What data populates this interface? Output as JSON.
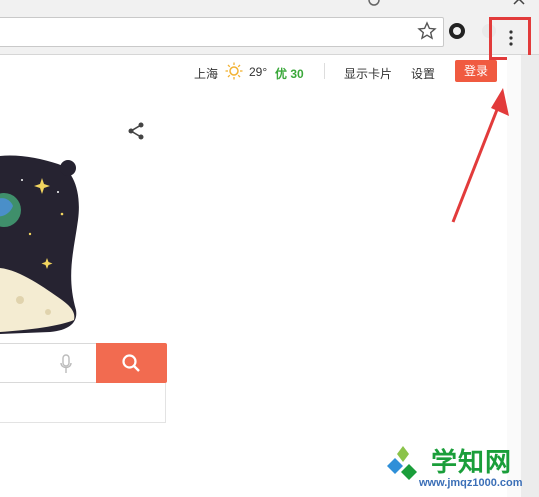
{
  "browser": {
    "icons": [
      "star-icon",
      "extension-icon",
      "extension-icon",
      "more-vert-icon",
      "close-icon"
    ]
  },
  "header": {
    "city": "上海",
    "temperature": "29°",
    "air_quality": "优 30",
    "show_cards": "显示卡片",
    "settings": "设置",
    "login": "登录"
  },
  "colors": {
    "accent": "#f05a40",
    "highlight": "#e23b3b",
    "air_quality": "#3aa83a"
  },
  "watermark": {
    "title": "学知网",
    "url": "www.jmqz1000.com"
  }
}
